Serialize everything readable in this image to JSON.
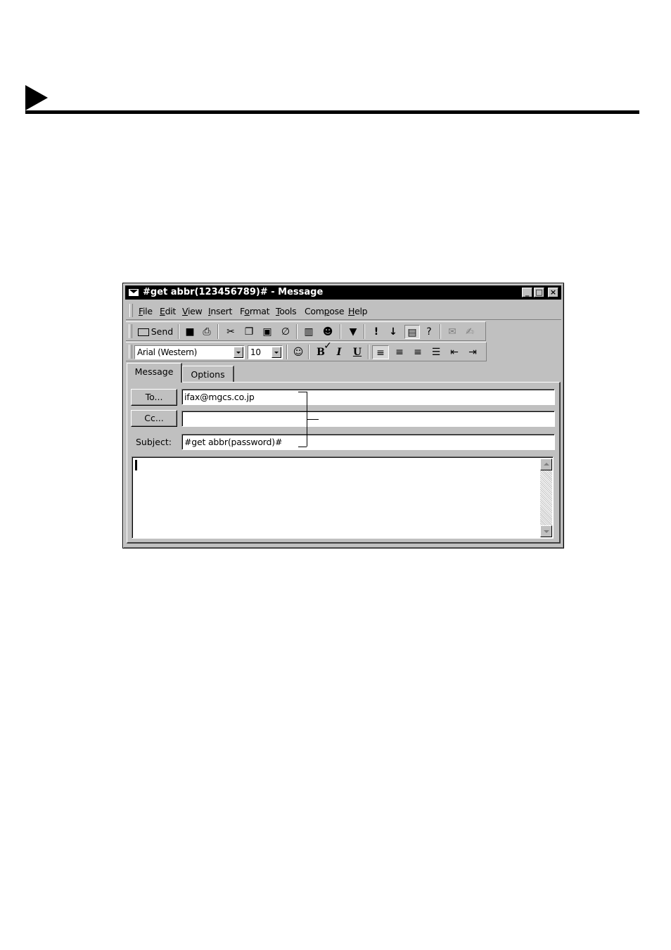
{
  "window": {
    "title": "#get abbr(123456789)# - Message",
    "controls": {
      "minimize": "_",
      "maximize": "□",
      "close": "×"
    }
  },
  "menu": [
    {
      "label": "File",
      "mnemonic": "F"
    },
    {
      "label": "Edit",
      "mnemonic": "E"
    },
    {
      "label": "View",
      "mnemonic": "V"
    },
    {
      "label": "Insert",
      "mnemonic": "I"
    },
    {
      "label": "Format",
      "mnemonic": "o"
    },
    {
      "label": "Tools",
      "mnemonic": "T"
    },
    {
      "label": "Compose",
      "mnemonic": "p"
    },
    {
      "label": "Help",
      "mnemonic": "H"
    }
  ],
  "toolbar": {
    "send_label": "Send",
    "icons": [
      "send-icon",
      "save-icon",
      "print-icon",
      "cut-icon",
      "copy-icon",
      "paste-icon",
      "attach-icon",
      "address-book-icon",
      "check-names-icon",
      "flag-icon",
      "high-importance-icon",
      "low-importance-icon",
      "properties-icon",
      "help-icon",
      "sign-icon",
      "encrypt-icon"
    ]
  },
  "format_bar": {
    "font": "Arial (Western)",
    "size": "10",
    "bold": "B",
    "italic": "I",
    "underline": "U"
  },
  "tabs": [
    {
      "label": "Message",
      "active": true
    },
    {
      "label": "Options",
      "active": false
    }
  ],
  "fields": {
    "to_button": "To...",
    "to_value": "ifax@mgcs.co.jp",
    "cc_button": "Cc...",
    "cc_value": "",
    "subject_label": "Subject:",
    "subject_value": "#get abbr(password)#"
  },
  "body": {
    "text": ""
  }
}
